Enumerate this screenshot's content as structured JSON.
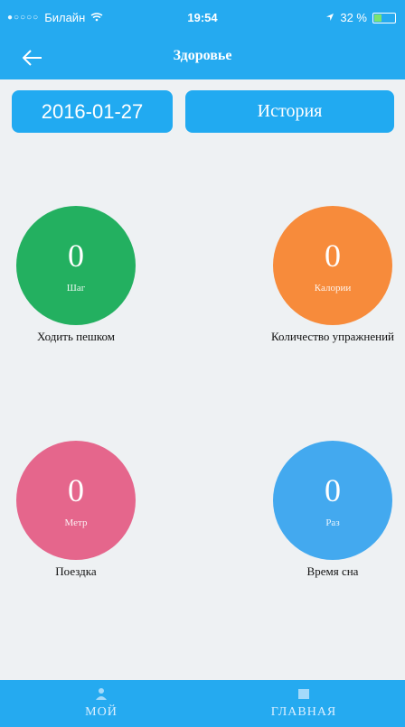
{
  "status_bar": {
    "carrier": "Билайн",
    "time": "19:54",
    "battery": "32 %",
    "battery_level": 0.32
  },
  "navbar": {
    "title": "Здоровье"
  },
  "controls": {
    "date": "2016-01-27",
    "history_label": "История"
  },
  "metrics": [
    {
      "value": "0",
      "unit": "Шаг",
      "label": "Ходить пешком",
      "color": "#23b060"
    },
    {
      "value": "0",
      "unit": "Калории",
      "label": "Количество упражнений",
      "color": "#f78b3b"
    },
    {
      "value": "0",
      "unit": "Метр",
      "label": "Поездка",
      "color": "#e5668c"
    },
    {
      "value": "0",
      "unit": "Раз",
      "label": "Время сна",
      "color": "#43a9ef"
    }
  ],
  "tabs": [
    {
      "label": "МОЙ",
      "icon": "user-icon"
    },
    {
      "label": "ГЛАВНАЯ",
      "icon": "home-icon"
    }
  ],
  "colors": {
    "primary": "#25aaf0",
    "background": "#eef1f3"
  }
}
